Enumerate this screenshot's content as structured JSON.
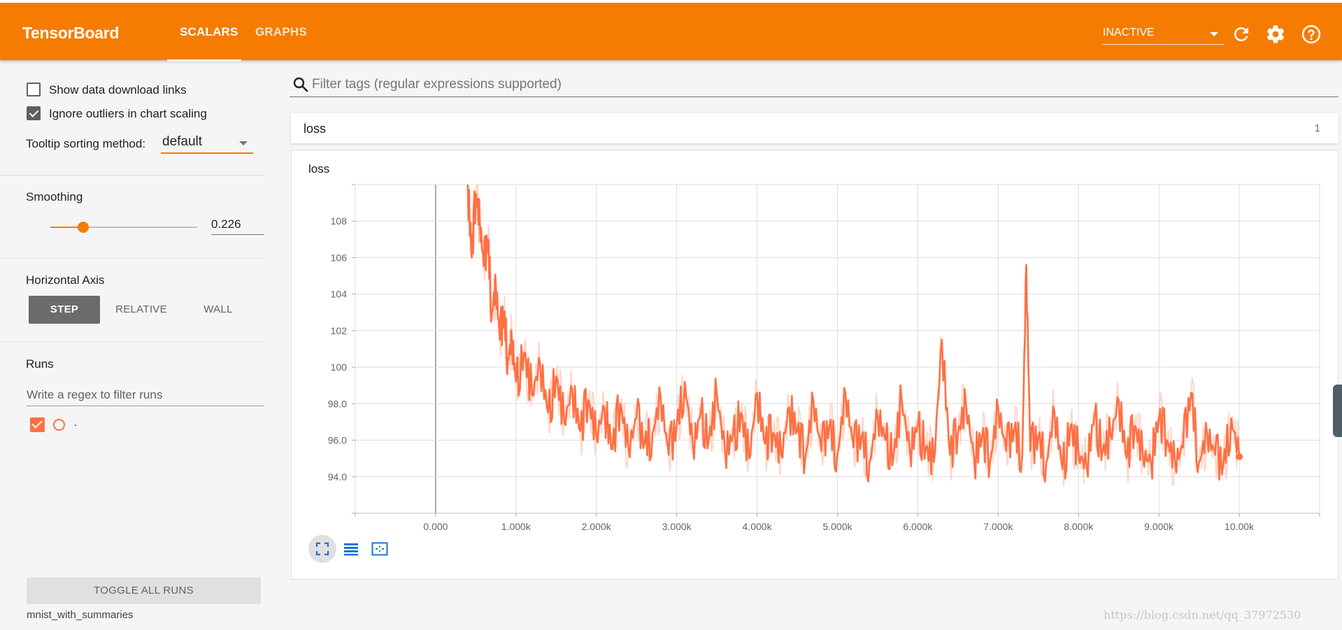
{
  "header": {
    "brand": "TensorBoard",
    "tabs": [
      {
        "label": "SCALARS",
        "active": true
      },
      {
        "label": "GRAPHS",
        "active": false
      }
    ],
    "run_select_value": "INACTIVE",
    "icons": [
      "refresh-icon",
      "settings-gear-icon",
      "help-icon"
    ],
    "bg_color": "#f57c00"
  },
  "sidebar": {
    "show_download_links": {
      "label": "Show data download links",
      "checked": false
    },
    "ignore_outliers": {
      "label": "Ignore outliers in chart scaling",
      "checked": true
    },
    "tooltip_sorting_label": "Tooltip sorting method:",
    "tooltip_sorting_value": "default",
    "smoothing_label": "Smoothing",
    "smoothing_value": "0.226",
    "horizontal_axis_label": "Horizontal Axis",
    "horizontal_axis_options": [
      {
        "label": "STEP",
        "active": true
      },
      {
        "label": "RELATIVE",
        "active": false
      },
      {
        "label": "WALL",
        "active": false
      }
    ],
    "runs_label": "Runs",
    "runs_filter_placeholder": "Write a regex to filter runs",
    "runs": [
      {
        "name": ".",
        "checked": true,
        "color": "#ff7043"
      }
    ],
    "toggle_all_label": "TOGGLE ALL RUNS",
    "logdir": "mnist_with_summaries"
  },
  "main": {
    "filter_placeholder": "Filter tags (regular expressions supported)",
    "category": {
      "name": "loss",
      "count": "1"
    },
    "card_title": "loss",
    "tools": [
      "fit-domain-icon",
      "data-selection-icon",
      "zoom-box-icon"
    ]
  },
  "chart_data": {
    "type": "line",
    "title": "loss",
    "xlabel": "",
    "ylabel": "",
    "x_tick_labels": [
      "0.000",
      "1.000k",
      "2.000k",
      "3.000k",
      "4.000k",
      "5.000k",
      "6.000k",
      "7.000k",
      "8.000k",
      "9.000k",
      "10.00k"
    ],
    "y_tick_labels": [
      "94.0",
      "96.0",
      "98.0",
      "100",
      "102",
      "104",
      "106",
      "108"
    ],
    "xlim": [
      -1000,
      11000
    ],
    "ylim": [
      92,
      110
    ],
    "grid": true,
    "smoothed_color": "#ff7043",
    "raw_color": "#ffccbc",
    "series": [
      {
        "name": ".",
        "x": [
          400,
          450,
          500,
          550,
          600,
          650,
          700,
          750,
          800,
          850,
          900,
          950,
          1000,
          1100,
          1200,
          1300,
          1400,
          1500,
          1600,
          1700,
          1800,
          1900,
          2000,
          2100,
          2200,
          2300,
          2400,
          2500,
          2600,
          2700,
          2800,
          2900,
          3000,
          3100,
          3200,
          3300,
          3400,
          3500,
          3600,
          3700,
          3800,
          3900,
          4000,
          4100,
          4200,
          4300,
          4400,
          4500,
          4600,
          4700,
          4800,
          4900,
          5000,
          5100,
          5200,
          5300,
          5400,
          5500,
          5600,
          5700,
          5800,
          5900,
          6000,
          6100,
          6200,
          6300,
          6400,
          6500,
          6600,
          6700,
          6800,
          6900,
          7000,
          7100,
          7200,
          7300,
          7350,
          7400,
          7500,
          7600,
          7700,
          7800,
          7900,
          8000,
          8100,
          8200,
          8300,
          8400,
          8500,
          8600,
          8700,
          8800,
          8900,
          9000,
          9100,
          9200,
          9300,
          9400,
          9500,
          9600,
          9700,
          9800,
          9900,
          10000
        ],
        "y": [
          110,
          106,
          109.5,
          108,
          105.5,
          107,
          103,
          104.5,
          101.5,
          103,
          100.5,
          101.5,
          99.2,
          100.8,
          98.5,
          100.2,
          97.5,
          99.5,
          97,
          98.8,
          96.5,
          98.2,
          96.2,
          97.8,
          95.5,
          98,
          95.5,
          97.2,
          95.8,
          96.4,
          98.4,
          95.2,
          96.8,
          99.2,
          95.6,
          97.5,
          96,
          98.5,
          95.4,
          96.2,
          97.5,
          95,
          98.6,
          95.8,
          96.4,
          95.2,
          97.8,
          96.5,
          95,
          98.2,
          95.4,
          96.8,
          95.2,
          98.6,
          95.6,
          96.2,
          94.8,
          97.4,
          96,
          95.2,
          98.2,
          95.4,
          96.8,
          95.6,
          94.8,
          101.5,
          95.2,
          96.4,
          98,
          95,
          96.2,
          94.8,
          97.8,
          95.4,
          96.6,
          95.2,
          105.6,
          95.4,
          96.2,
          94.8,
          97.6,
          94.4,
          96.8,
          95.2,
          94.6,
          97.4,
          95.4,
          96.2,
          98.2,
          95,
          96.8,
          95.2,
          94.8,
          97.2,
          96,
          94.8,
          95.6,
          98.6,
          94.8,
          96.4,
          95.2,
          94.6,
          97.2,
          95.1
        ]
      }
    ]
  }
}
